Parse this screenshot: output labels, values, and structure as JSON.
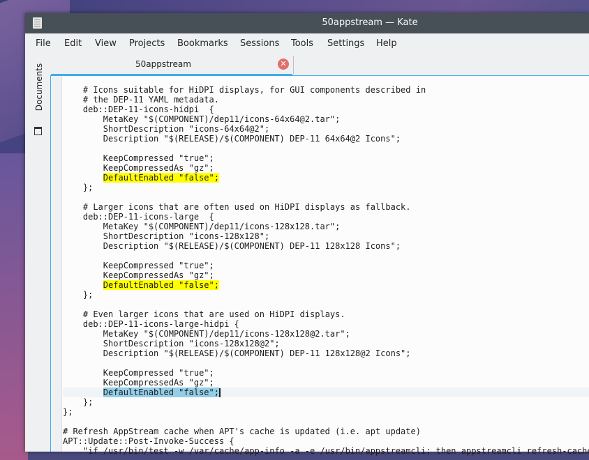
{
  "window": {
    "title": "50appstream — Kate"
  },
  "menu": [
    "File",
    "Edit",
    "View",
    "Projects",
    "Bookmarks",
    "Sessions",
    "Tools",
    "Settings",
    "Help"
  ],
  "side_panel": {
    "tab_label": "Documents"
  },
  "tab": {
    "label": "50appstream"
  },
  "code_lines": [
    {
      "indent": "    ",
      "text": "# Icons suitable for HiDPI displays, for GUI components described in"
    },
    {
      "indent": "    ",
      "text": "# the DEP-11 YAML metadata."
    },
    {
      "indent": "    ",
      "text": "deb::DEP-11-icons-hidpi  {"
    },
    {
      "indent": "        ",
      "text": "MetaKey \"$(COMPONENT)/dep11/icons-64x64@2.tar\";"
    },
    {
      "indent": "        ",
      "text": "ShortDescription \"icons-64x64@2\";"
    },
    {
      "indent": "        ",
      "text": "Description \"$(RELEASE)/$(COMPONENT) DEP-11 64x64@2 Icons\";"
    },
    {
      "indent": "",
      "text": ""
    },
    {
      "indent": "        ",
      "text": "KeepCompressed \"true\";"
    },
    {
      "indent": "        ",
      "text": "KeepCompressedAs \"gz\";"
    },
    {
      "indent": "        ",
      "text": "DefaultEnabled \"false\";",
      "highlight": "yellow"
    },
    {
      "indent": "    ",
      "text": "};"
    },
    {
      "indent": "",
      "text": ""
    },
    {
      "indent": "    ",
      "text": "# Larger icons that are often used on HiDPI displays as fallback."
    },
    {
      "indent": "    ",
      "text": "deb::DEP-11-icons-large  {"
    },
    {
      "indent": "        ",
      "text": "MetaKey \"$(COMPONENT)/dep11/icons-128x128.tar\";"
    },
    {
      "indent": "        ",
      "text": "ShortDescription \"icons-128x128\";"
    },
    {
      "indent": "        ",
      "text": "Description \"$(RELEASE)/$(COMPONENT) DEP-11 128x128 Icons\";"
    },
    {
      "indent": "",
      "text": ""
    },
    {
      "indent": "        ",
      "text": "KeepCompressed \"true\";"
    },
    {
      "indent": "        ",
      "text": "KeepCompressedAs \"gz\";"
    },
    {
      "indent": "        ",
      "text": "DefaultEnabled \"false\";",
      "highlight": "yellow"
    },
    {
      "indent": "    ",
      "text": "};"
    },
    {
      "indent": "",
      "text": ""
    },
    {
      "indent": "    ",
      "text": "# Even larger icons that are used on HiDPI displays."
    },
    {
      "indent": "    ",
      "text": "deb::DEP-11-icons-large-hidpi {"
    },
    {
      "indent": "        ",
      "text": "MetaKey \"$(COMPONENT)/dep11/icons-128x128@2.tar\";"
    },
    {
      "indent": "        ",
      "text": "ShortDescription \"icons-128x128@2\";"
    },
    {
      "indent": "        ",
      "text": "Description \"$(RELEASE)/$(COMPONENT) DEP-11 128x128@2 Icons\";"
    },
    {
      "indent": "",
      "text": ""
    },
    {
      "indent": "        ",
      "text": "KeepCompressed \"true\";"
    },
    {
      "indent": "        ",
      "text": "KeepCompressedAs \"gz\";"
    },
    {
      "indent": "        ",
      "text": "DefaultEnabled \"false\";",
      "highlight": "selected",
      "current": true
    },
    {
      "indent": "    ",
      "text": "};"
    },
    {
      "indent": "",
      "text": "};"
    },
    {
      "indent": "",
      "text": ""
    },
    {
      "indent": "",
      "text": "# Refresh AppStream cache when APT's cache is updated (i.e. apt update)"
    },
    {
      "indent": "",
      "text": "APT::Update::Post-Invoke-Success {"
    },
    {
      "indent": "    ",
      "text": "\"if /usr/bin/test -w /var/cache/app-info -a -e /usr/bin/appstreamcli; then appstreamcli refresh-cache"
    }
  ],
  "colors": {
    "accent": "#3daee9",
    "titlebar": "#475057",
    "highlight_yellow": "#ffff00",
    "selection": "#93cee9"
  },
  "icons": {
    "app": "document-icon",
    "close_tab": "close-icon",
    "side_panel": "folder-icon"
  }
}
